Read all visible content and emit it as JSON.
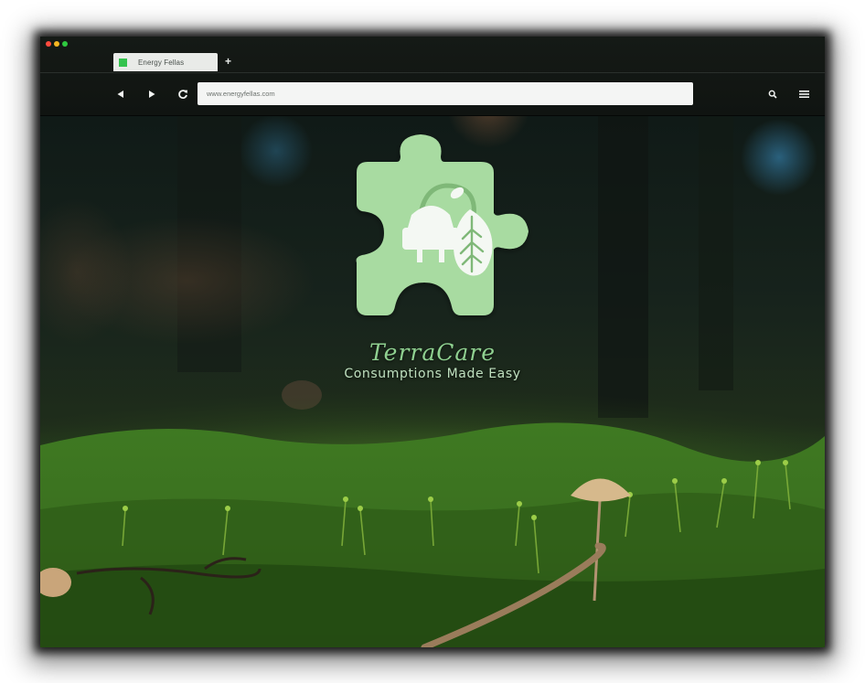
{
  "browser": {
    "tab": {
      "title": "Energy Fellas"
    },
    "new_tab_label": "+",
    "address_bar": {
      "url": "www.energyfellas.com"
    },
    "icons": {
      "back": "back-arrow-icon",
      "forward": "forward-arrow-icon",
      "reload": "reload-icon",
      "search": "search-icon",
      "menu": "hamburger-menu-icon"
    }
  },
  "hero": {
    "brand_name": "TerraCare",
    "tagline": "Consumptions Made Easy",
    "logo": "puzzle-piece-plug-leaf-logo"
  },
  "colors": {
    "logo_green": "#a8dba1",
    "brand_green": "#8fd090",
    "moss_green": "#3c7a28"
  }
}
